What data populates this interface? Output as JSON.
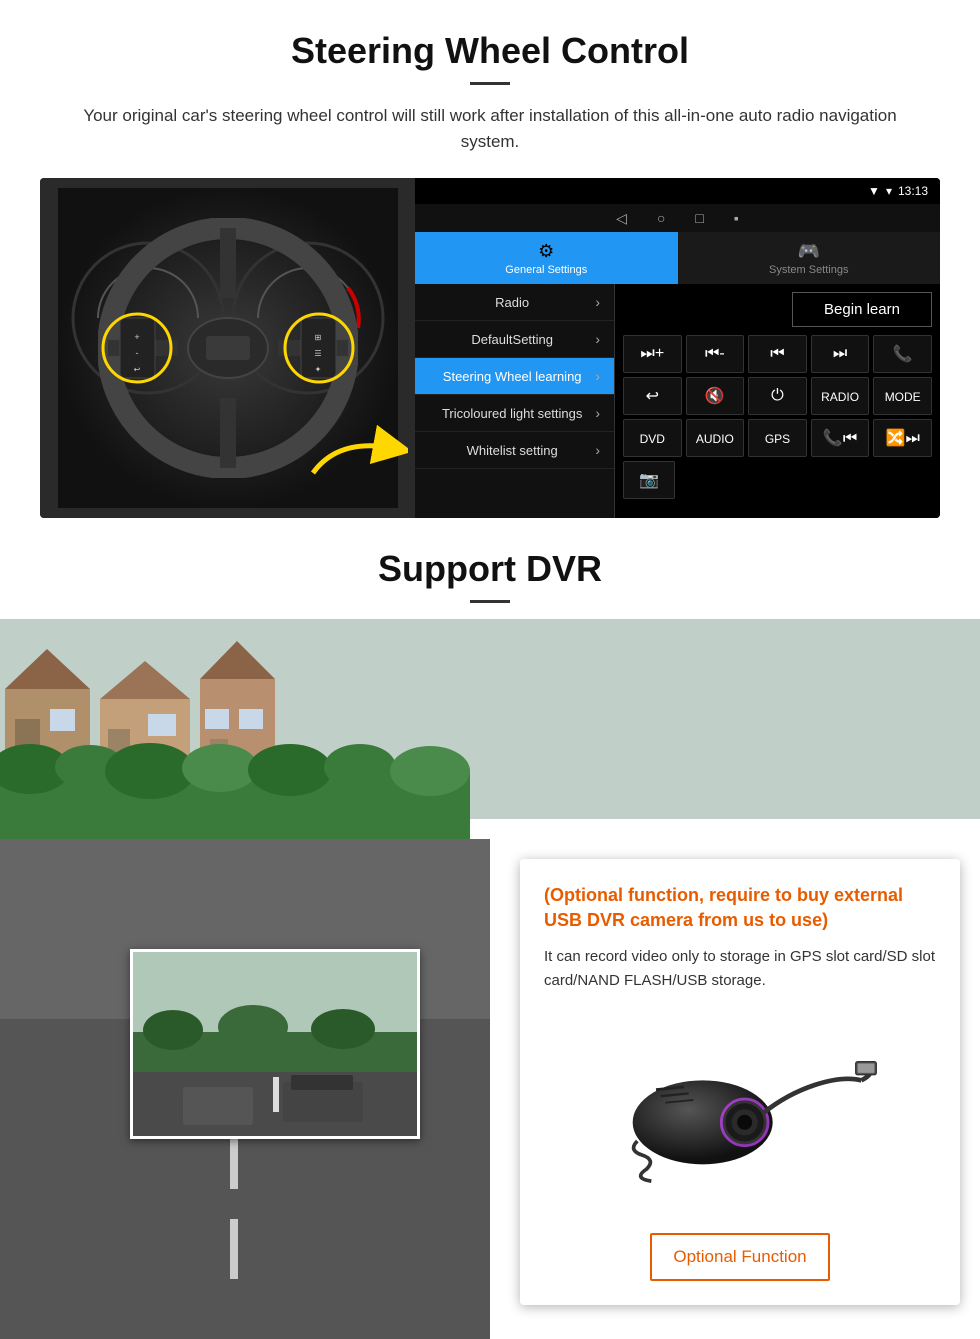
{
  "page": {
    "section1": {
      "title": "Steering Wheel Control",
      "subtitle": "Your original car's steering wheel control will still work after installation of this all-in-one auto radio navigation system.",
      "android_ui": {
        "statusbar": {
          "time": "13:13",
          "signal": "▼",
          "wifi": "▾"
        },
        "nav_icons": [
          "◁",
          "○",
          "□",
          "▪"
        ],
        "tabs": [
          {
            "icon": "⚙",
            "label": "General Settings",
            "active": true
          },
          {
            "icon": "🎮",
            "label": "System Settings",
            "active": false
          }
        ],
        "menu_items": [
          {
            "label": "Radio",
            "active": false
          },
          {
            "label": "DefaultSetting",
            "active": false
          },
          {
            "label": "Steering Wheel learning",
            "active": true
          },
          {
            "label": "Tricoloured light settings",
            "active": false
          },
          {
            "label": "Whitelist setting",
            "active": false
          }
        ],
        "begin_learn_label": "Begin learn",
        "control_buttons_row1": [
          "⏮+",
          "⏮-",
          "⏮⏮",
          "⏭⏭",
          "📞"
        ],
        "control_buttons_row2": [
          "↩",
          "🔇",
          "⏻",
          "RADIO",
          "MODE"
        ],
        "control_buttons_row3": [
          "DVD",
          "AUDIO",
          "GPS",
          "📞⏮",
          "🔀⏭"
        ],
        "control_buttons_row4": [
          "📷"
        ]
      }
    },
    "section2": {
      "title": "Support DVR",
      "optional_title": "(Optional function, require to buy external USB DVR camera from us to use)",
      "description": "It can record video only to storage in GPS slot card/SD slot card/NAND FLASH/USB storage.",
      "optional_function_label": "Optional Function"
    }
  }
}
